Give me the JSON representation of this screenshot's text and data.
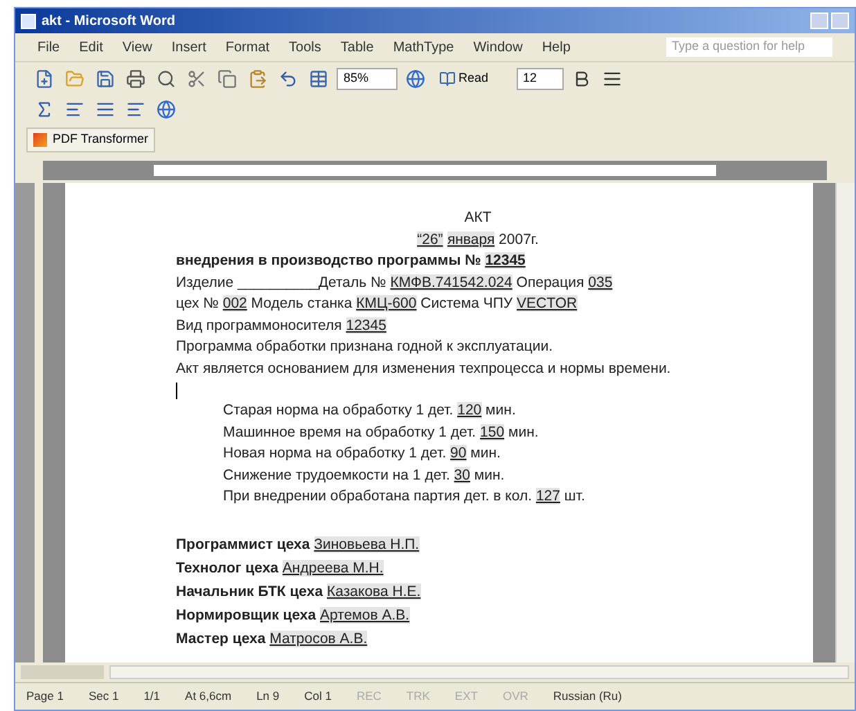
{
  "window": {
    "title": "akt - Microsoft Word"
  },
  "menu": [
    "File",
    "Edit",
    "View",
    "Insert",
    "Format",
    "Tools",
    "Table",
    "MathType",
    "Window",
    "Help"
  ],
  "help_search": {
    "placeholder": "Type a question for help"
  },
  "toolbar": {
    "zoom": "85%",
    "read": "Read",
    "font_size": "12"
  },
  "pdf_toolbar": {
    "label": "PDF Transformer"
  },
  "document": {
    "lines": [
      {
        "kind": "centered",
        "parts": [
          {
            "kind": "text",
            "text": "АКТ"
          }
        ]
      },
      {
        "kind": "centered",
        "parts": [
          {
            "kind": "field",
            "text": "“26”"
          },
          {
            "kind": "spaced_field",
            "text": "января"
          },
          {
            "kind": "text",
            "text": "  2007г."
          }
        ]
      },
      {
        "kind": "bold",
        "parts": [
          {
            "kind": "text",
            "text": "внедрения в производство программы № "
          },
          {
            "kind": "field",
            "text": "12345"
          }
        ]
      },
      {
        "kind": "plain",
        "parts": [
          {
            "kind": "text",
            "text": "Изделие __________Деталь № "
          },
          {
            "kind": "field",
            "text": "КМФВ.741542.024"
          },
          {
            "kind": "text",
            "text": "  Операция "
          },
          {
            "kind": "field",
            "text": "035"
          }
        ]
      },
      {
        "kind": "plain",
        "parts": [
          {
            "kind": "text",
            "text": "цех № "
          },
          {
            "kind": "field",
            "text": "002"
          },
          {
            "kind": "text",
            "text": " Модель станка "
          },
          {
            "kind": "field",
            "text": "КМЦ-600"
          },
          {
            "kind": "text",
            "text": "  Система ЧПУ "
          },
          {
            "kind": "field",
            "text": "VECTOR"
          }
        ]
      },
      {
        "kind": "plain",
        "parts": [
          {
            "kind": "text",
            "text": "Вид программоносителя "
          },
          {
            "kind": "field",
            "text": "12345"
          }
        ]
      },
      {
        "kind": "plain",
        "parts": [
          {
            "kind": "text",
            "text": "Программа обработки признана годной к эксплуатации."
          }
        ]
      },
      {
        "kind": "plain",
        "parts": [
          {
            "kind": "text",
            "text": "Акт является основанием для изменения техпроцесса и нормы времени."
          }
        ]
      },
      {
        "kind": "cursor"
      },
      {
        "kind": "indented",
        "parts": [
          {
            "kind": "text",
            "text": "Старая норма на обработку 1 дет. "
          },
          {
            "kind": "field",
            "text": "120"
          },
          {
            "kind": "text",
            "text": " мин."
          }
        ]
      },
      {
        "kind": "indented",
        "parts": [
          {
            "kind": "text",
            "text": "Машинное время на обработку 1 дет. "
          },
          {
            "kind": "field",
            "text": "150"
          },
          {
            "kind": "text",
            "text": " мин."
          }
        ]
      },
      {
        "kind": "indented",
        "parts": [
          {
            "kind": "text",
            "text": "Новая норма на обработку 1 дет. "
          },
          {
            "kind": "field",
            "text": "90"
          },
          {
            "kind": "text",
            "text": " мин."
          }
        ]
      },
      {
        "kind": "indented",
        "parts": [
          {
            "kind": "text",
            "text": "Снижение трудоемкости на 1 дет. "
          },
          {
            "kind": "field",
            "text": "30"
          },
          {
            "kind": "text",
            "text": " мин."
          }
        ]
      },
      {
        "kind": "indented",
        "parts": [
          {
            "kind": "text",
            "text": "При внедрении обработана партия дет. в кол. "
          },
          {
            "kind": "field",
            "text": "127"
          },
          {
            "kind": "text",
            "text": " шт."
          }
        ]
      }
    ],
    "signatures": [
      {
        "role": "Программист цеха",
        "name": "Зиновьева Н.П."
      },
      {
        "role": "Технолог цеха",
        "name": "Андреева М.Н."
      },
      {
        "role": "Начальник БТК цеха",
        "name": "Казакова Н.Е."
      },
      {
        "role": "Нормировщик цеха",
        "name": "Артемов А.В."
      },
      {
        "role": "Мастер цеха",
        "name": "Матросов А.В."
      }
    ]
  },
  "status_bar": [
    "Page 1",
    "Sec 1",
    "1/1",
    "At 6,6cm",
    "Ln 9",
    "Col 1",
    "REC",
    "TRK",
    "EXT",
    "OVR",
    "Russian (Ru)"
  ]
}
